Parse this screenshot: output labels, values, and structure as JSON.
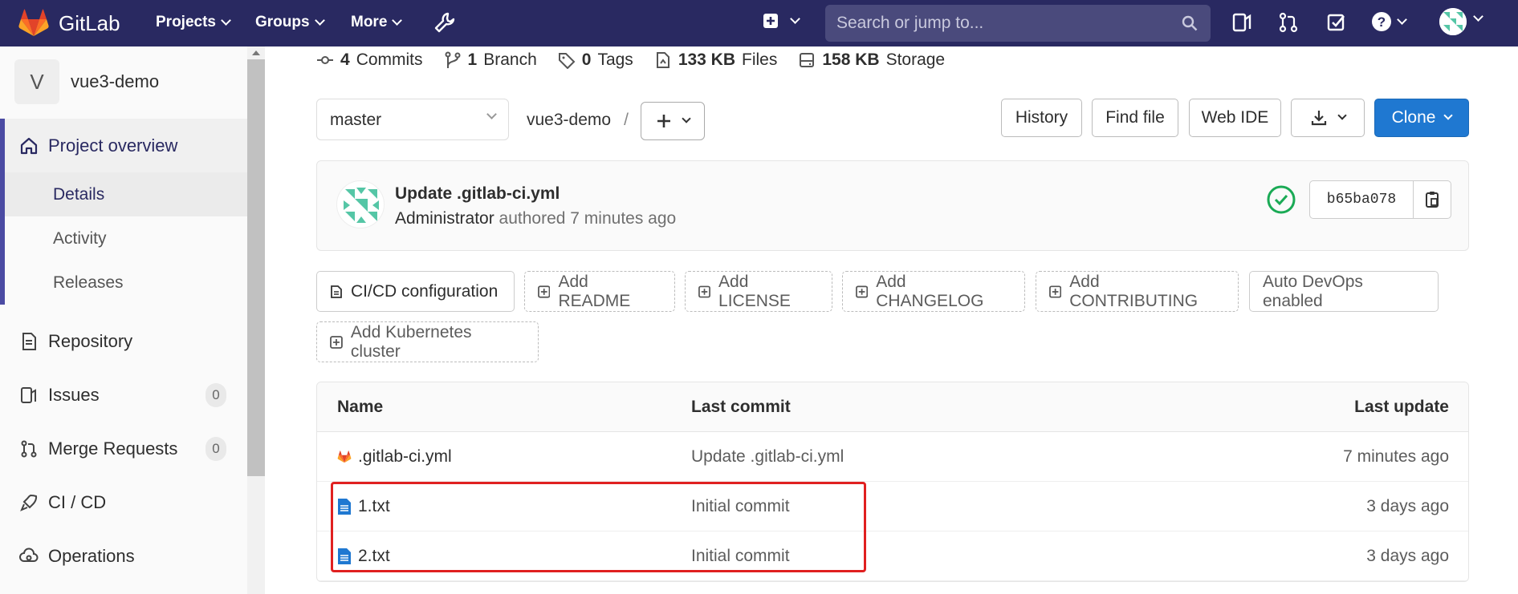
{
  "topnav": {
    "brand": "GitLab",
    "menu": [
      "Projects",
      "Groups",
      "More"
    ],
    "search_placeholder": "Search or jump to...",
    "accent": "#292961"
  },
  "sidebar": {
    "project_initial": "V",
    "project_name": "vue3-demo",
    "overview": "Project overview",
    "sub": [
      "Details",
      "Activity",
      "Releases"
    ],
    "items": [
      {
        "label": "Repository",
        "icon": "repository-icon"
      },
      {
        "label": "Issues",
        "icon": "issues-icon",
        "count": "0"
      },
      {
        "label": "Merge Requests",
        "icon": "merge-request-icon",
        "count": "0"
      },
      {
        "label": "CI / CD",
        "icon": "rocket-icon"
      },
      {
        "label": "Operations",
        "icon": "cloud-gear-icon"
      }
    ]
  },
  "stats": {
    "commits_num": "4",
    "commits_label": "Commits",
    "branch_num": "1",
    "branch_label": "Branch",
    "tags_num": "0",
    "tags_label": "Tags",
    "files_num": "133 KB",
    "files_label": "Files",
    "storage_num": "158 KB",
    "storage_label": "Storage"
  },
  "toolbar": {
    "branch": "master",
    "path": "vue3-demo",
    "sep": "/",
    "history": "History",
    "find_file": "Find file",
    "web_ide": "Web IDE",
    "clone": "Clone"
  },
  "commit": {
    "title": "Update .gitlab-ci.yml",
    "author": "Administrator",
    "meta": "authored 7 minutes ago",
    "sha": "b65ba078",
    "status_color": "#1aaa55"
  },
  "quick": {
    "cicd": "CI/CD configuration",
    "readme": "Add README",
    "license": "Add LICENSE",
    "changelog": "Add CHANGELOG",
    "contributing": "Add CONTRIBUTING",
    "devops": "Auto DevOps enabled",
    "k8s": "Add Kubernetes cluster"
  },
  "table": {
    "headers": [
      "Name",
      "Last commit",
      "Last update"
    ],
    "rows": [
      {
        "name": ".gitlab-ci.yml",
        "commit": "Update .gitlab-ci.yml",
        "updated": "7 minutes ago",
        "icon": "gitlab-icon"
      },
      {
        "name": "1.txt",
        "commit": "Initial commit",
        "updated": "3 days ago",
        "icon": "file-text-icon"
      },
      {
        "name": "2.txt",
        "commit": "Initial commit",
        "updated": "3 days ago",
        "icon": "file-text-icon"
      }
    ]
  }
}
